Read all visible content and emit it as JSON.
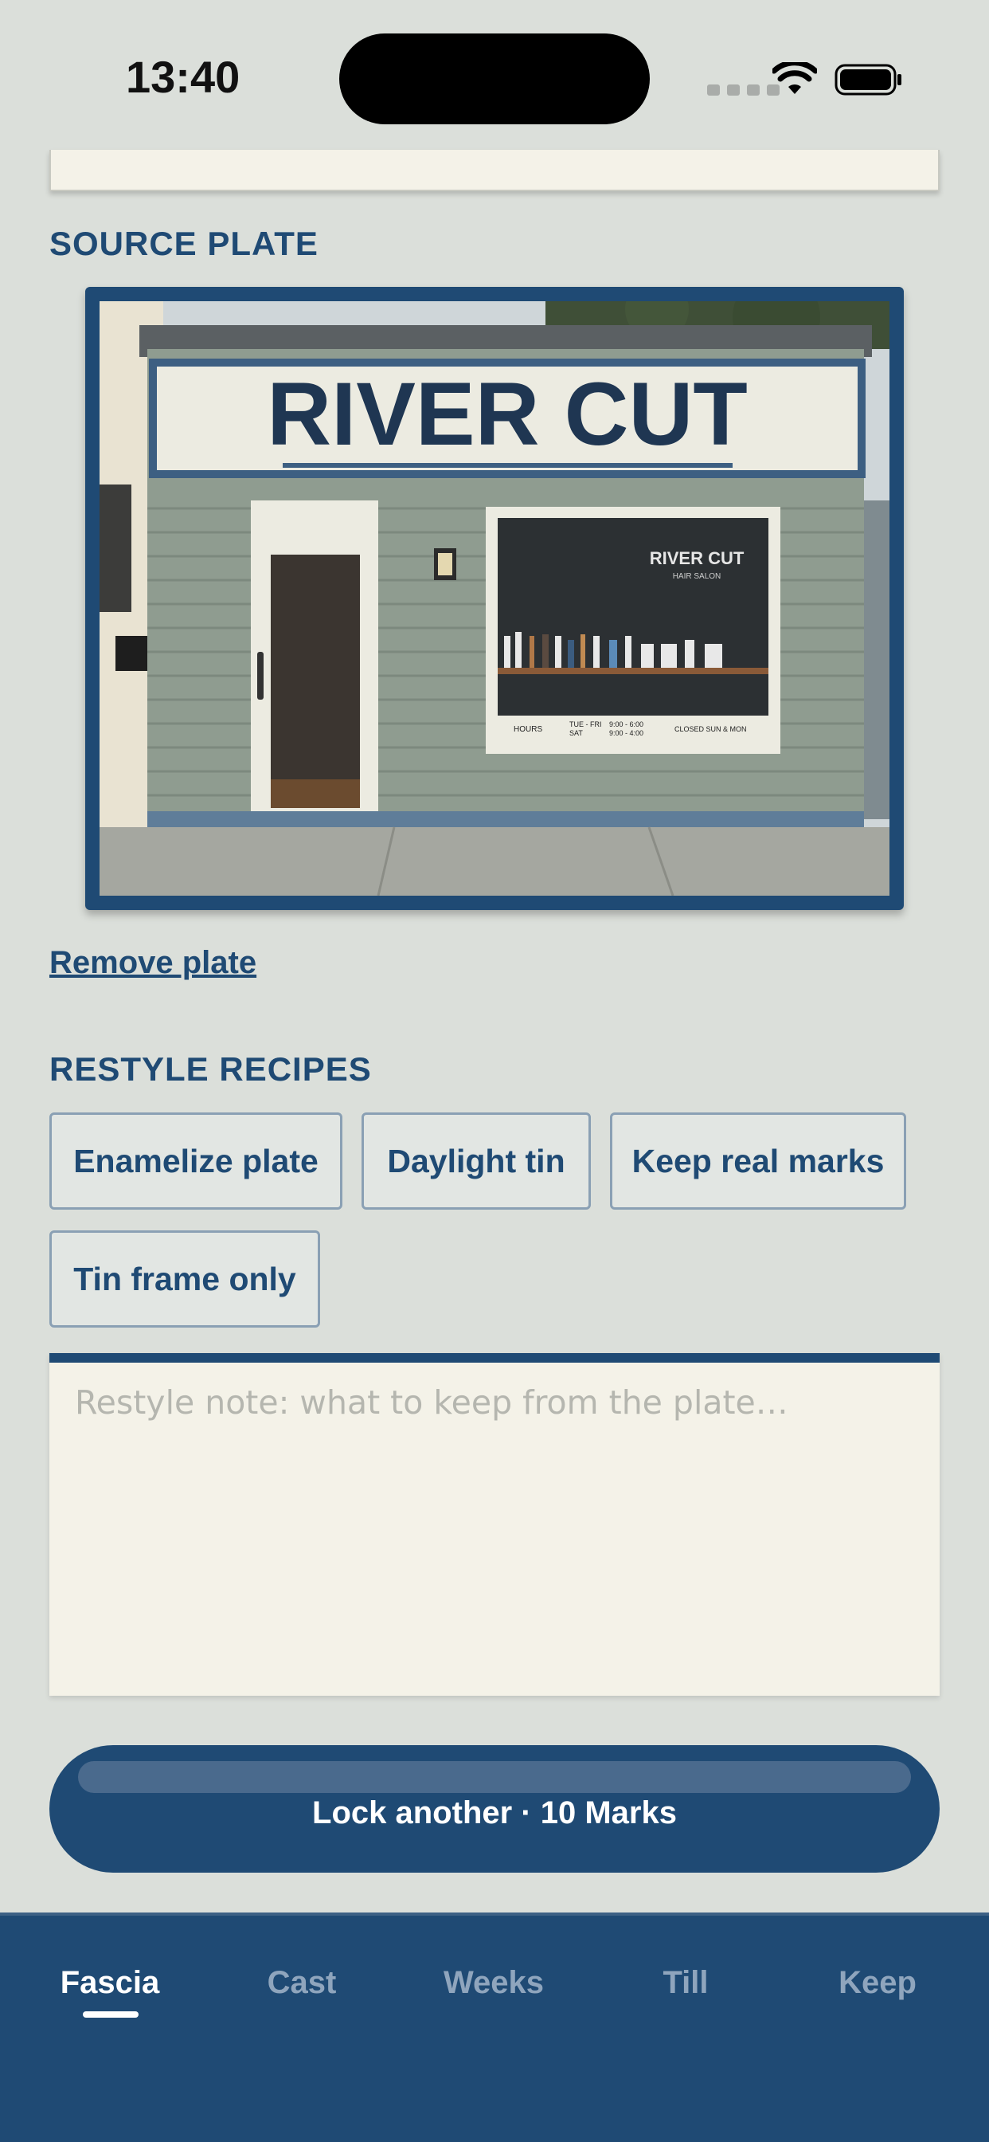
{
  "status_bar": {
    "time": "13:40"
  },
  "colors": {
    "accent": "#1f4a74",
    "background": "#dbdfda",
    "paper": "#f4f2e8"
  },
  "source_plate": {
    "label": "SOURCE PLATE",
    "image": {
      "sign_text": "RIVER CUT",
      "window_logo": "RIVER CUT",
      "window_logo_sub": "HAIR SALON",
      "hours_label": "HOURS",
      "hours_days_1": "TUE - FRI",
      "hours_time_1": "9:00 - 6:00",
      "hours_days_2": "SAT",
      "hours_time_2": "9:00 - 4:00",
      "closed": "CLOSED SUN & MON"
    },
    "remove_label": "Remove plate"
  },
  "recipes": {
    "label": "RESTYLE RECIPES",
    "chips": [
      "Enamelize plate",
      "Daylight tin",
      "Keep real marks",
      "Tin frame only"
    ]
  },
  "note": {
    "placeholder": "Restyle note: what to keep from the plate…"
  },
  "cta": {
    "label": "Lock another · 10 Marks"
  },
  "tabs": [
    "Fascia",
    "Cast",
    "Weeks",
    "Till",
    "Keep"
  ],
  "active_tab": "Fascia"
}
